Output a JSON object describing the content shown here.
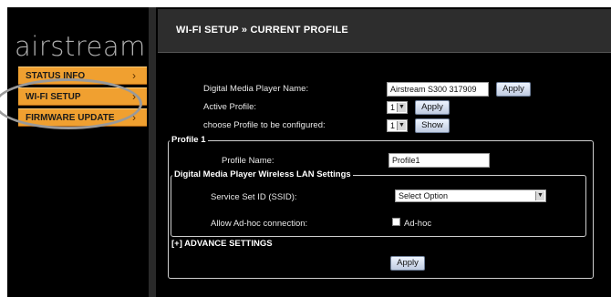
{
  "brand": {
    "logo_text": "airstream"
  },
  "sidebar": {
    "items": [
      {
        "label": "STATUS INFO",
        "chevron": "›"
      },
      {
        "label": "WI-FI SETUP",
        "chevron": "›"
      },
      {
        "label": "FIRMWARE UPDATE",
        "chevron": "›"
      }
    ]
  },
  "header": {
    "title": "WI-FI SETUP » CURRENT PROFILE"
  },
  "form": {
    "player_name_label": "Digital Media Player Name:",
    "player_name_value": "Airstream S300 317909",
    "apply_label": "Apply",
    "active_profile_label": "Active Profile:",
    "active_profile_value": "1",
    "choose_profile_label": "choose Profile to be configured:",
    "choose_profile_value": "1",
    "show_label": "Show"
  },
  "profile": {
    "legend": "Profile 1",
    "name_label": "Profile Name:",
    "name_value": "Profile1",
    "wlan": {
      "legend": "Digital Media Player Wireless LAN Settings",
      "ssid_label": "Service Set ID (SSID):",
      "ssid_value": "Select Option",
      "adhoc_label": "Allow Ad-hoc connection:",
      "adhoc_checkbox_label": "Ad-hoc"
    },
    "advance_label": "[+] ADVANCE SETTINGS",
    "apply_label": "Apply"
  },
  "colors": {
    "menu_orange": "#f0a030",
    "panel_bg": "#000000",
    "header_bg": "#2d2d2d"
  }
}
